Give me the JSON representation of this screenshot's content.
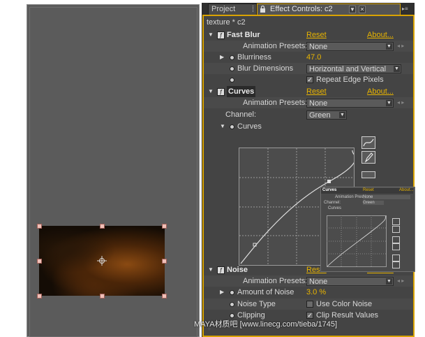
{
  "tabs": {
    "project": "Project",
    "effect_controls": "Effect Controls: c2"
  },
  "layer_path": "texture * c2",
  "fast_blur": {
    "name": "Fast Blur",
    "reset": "Reset",
    "about": "About...",
    "presets_label": "Animation Presets:",
    "presets_value": "None",
    "blurriness_label": "Blurriness",
    "blurriness_value": "47.0",
    "dims_label": "Blur Dimensions",
    "dims_value": "Horizontal and Vertical",
    "repeat_label": "Repeat Edge Pixels"
  },
  "curves": {
    "name": "Curves",
    "reset": "Reset",
    "about": "About...",
    "presets_label": "Animation Presets:",
    "presets_value": "None",
    "channel_label": "Channel:",
    "channel_value": "Green",
    "curves_label": "Curves"
  },
  "noise": {
    "name": "Noise",
    "reset": "Reset",
    "about": "About...",
    "presets_label": "Animation Presets:",
    "presets_value": "None",
    "amount_label": "Amount of Noise",
    "amount_value": "3.0 %",
    "type_label": "Noise Type",
    "use_color_label": "Use Color Noise",
    "clipping_label": "Clipping",
    "clip_result_label": "Clip Result Values"
  },
  "thumb": {
    "name": "Curves",
    "reset": "Reset",
    "about": "About...",
    "presets_label": "Animation Presets:",
    "presets_value": "None",
    "channel_label": "Channel:",
    "channel_value": "Green",
    "curves_label": "Curves"
  },
  "watermark": "MAYA材质吧 [www.linecg.com/tieba/1745]",
  "colors": {
    "accent": "#d9a300",
    "link": "#e8b400",
    "panel_bg": "#444444",
    "comp_bg": "#5b5b5b"
  },
  "icons": [
    "lock-icon",
    "menu-arrow-icon",
    "close-icon",
    "fx-icon",
    "stopwatch-icon",
    "curve-tool-icon",
    "pencil-tool-icon",
    "anchor-point-icon"
  ]
}
